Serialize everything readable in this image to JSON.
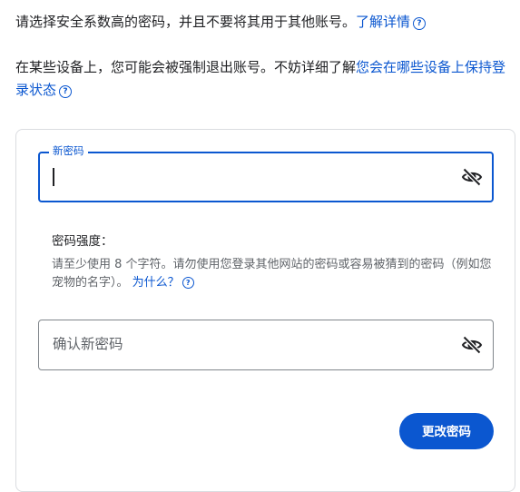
{
  "intro": {
    "line1_text": "请选择安全系数高的密码，并且不要将其用于其他账号。",
    "line1_link": "了解详情",
    "line2_text": "在某些设备上，您可能会被强制退出账号。不妨详细了解",
    "line2_link": "您会在哪些设备上保持登录状态"
  },
  "form": {
    "new_password_label": "新密码",
    "new_password_value": "",
    "strength_title": "密码强度：",
    "strength_hint": "请至少使用 8 个字符。请勿使用您登录其他网站的密码或容易被猜到的密码（例如您宠物的名字）。",
    "strength_hint_link": "为什么？",
    "confirm_placeholder": "确认新密码",
    "confirm_value": "",
    "submit_label": "更改密码"
  },
  "icons": {
    "help": "help-circle-icon",
    "toggle_visibility": "eye-off-icon"
  },
  "colors": {
    "accent": "#0b57d0",
    "text": "#202124",
    "muted": "#5f6368",
    "border": "#dadce0"
  }
}
